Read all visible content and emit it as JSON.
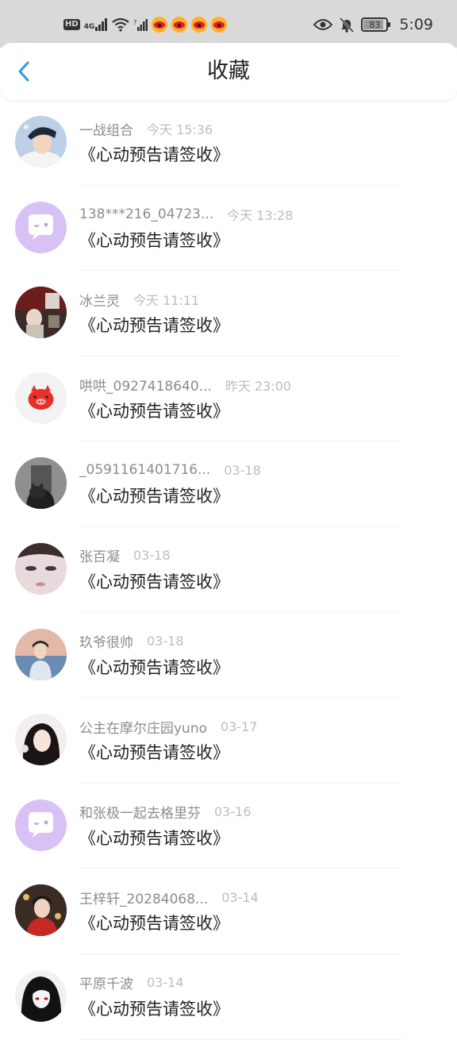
{
  "status_bar": {
    "hd": "HD",
    "net": "4G",
    "battery": "83",
    "battery_level": 0.83,
    "time": "5:09"
  },
  "header": {
    "title": "收藏"
  },
  "items": [
    {
      "name": "一战组合",
      "time": "今天 15:36",
      "title": "《心动预告请签收》",
      "avatar": "photo-boy-white-hat"
    },
    {
      "name": "138***216_04723...",
      "time": "今天 13:28",
      "title": "《心动预告请签收》",
      "avatar": "default-chat-avatar"
    },
    {
      "name": "冰兰灵",
      "time": "今天 11:11",
      "title": "《心动预告请签收》",
      "avatar": "photo-room"
    },
    {
      "name": "哄哄_0927418640...",
      "time": "昨天 23:00",
      "title": "《心动预告请签收》",
      "avatar": "red-pig-avatar"
    },
    {
      "name": "_0591161401716...",
      "time": "03-18",
      "title": "《心动预告请签收》",
      "avatar": "photo-dark-cat"
    },
    {
      "name": "张百凝",
      "time": "03-18",
      "title": "《心动预告请签收》",
      "avatar": "photo-face-closeup"
    },
    {
      "name": "玖爷很帅",
      "time": "03-18",
      "title": "《心动预告请签收》",
      "avatar": "photo-boy-sky"
    },
    {
      "name": "公主在摩尔庄园yuno",
      "time": "03-17",
      "title": "《心动预告请签收》",
      "avatar": "photo-girl"
    },
    {
      "name": "和张极一起去格里芬",
      "time": "03-16",
      "title": "《心动预告请签收》",
      "avatar": "default-chat-avatar"
    },
    {
      "name": "王梓轩_20284068...",
      "time": "03-14",
      "title": "《心动预告请签收》",
      "avatar": "photo-boy-red"
    },
    {
      "name": "平原千波",
      "time": "03-14",
      "title": "《心动预告请签收》",
      "avatar": "photo-anime-dark"
    }
  ],
  "colors": {
    "accent": "#2c9ae8",
    "default_avatar": "#d8c2f5",
    "name": "#8c8c8c",
    "time": "#bdbdbd"
  }
}
